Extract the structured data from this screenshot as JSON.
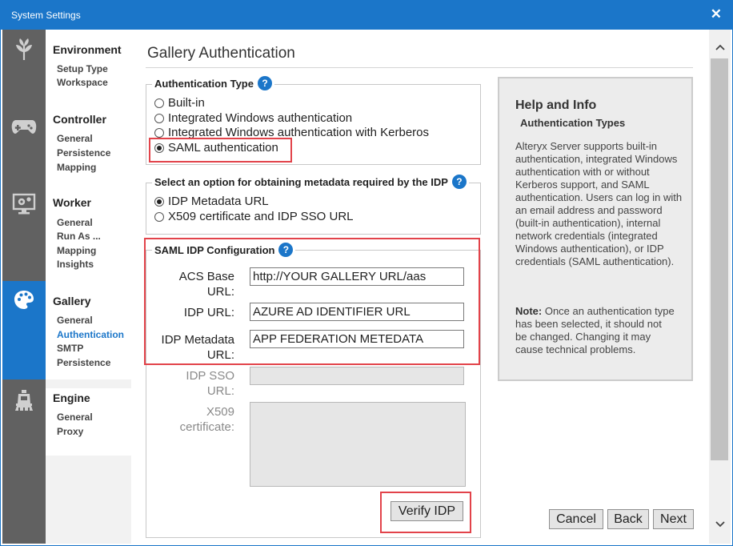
{
  "window": {
    "title": "System Settings",
    "close_icon": "close-icon"
  },
  "sidebar": {
    "groups": [
      {
        "heading": "Environment",
        "icon": "leaf-icon",
        "items": [
          "Setup Type",
          "Workspace"
        ]
      },
      {
        "heading": "Controller",
        "icon": "gamepad-icon",
        "items": [
          "General",
          "Persistence",
          "Mapping"
        ]
      },
      {
        "heading": "Worker",
        "icon": "monitor-gear-icon",
        "items": [
          "General",
          "Run As ...",
          "Mapping",
          "Insights"
        ]
      },
      {
        "heading": "Gallery",
        "icon": "palette-icon",
        "items": [
          "General",
          "Authentication",
          "SMTP",
          "Persistence"
        ],
        "active": true,
        "selected_item": "Authentication"
      },
      {
        "heading": "Engine",
        "icon": "train-icon",
        "items": [
          "General",
          "Proxy"
        ]
      }
    ]
  },
  "page": {
    "title": "Gallery Authentication"
  },
  "auth_type": {
    "legend": "Authentication Type",
    "options": [
      "Built-in",
      "Integrated Windows authentication",
      "Integrated Windows authentication with Kerberos",
      "SAML authentication"
    ],
    "selected": "SAML authentication"
  },
  "metadata_option": {
    "legend": "Select an option for obtaining metadata required by the IDP",
    "options": [
      "IDP Metadata URL",
      "X509 certificate and IDP SSO URL"
    ],
    "selected": "IDP Metadata URL"
  },
  "saml_config": {
    "legend": "SAML IDP Configuration",
    "acs_base_url": {
      "label_line1": "ACS Base",
      "label_line2": "URL:",
      "value": "http://YOUR GALLERY URL/aas"
    },
    "idp_url": {
      "label": "IDP URL:",
      "value": "AZURE AD IDENTIFIER URL"
    },
    "idp_metadata_url": {
      "label_line1": "IDP Metadata",
      "label_line2": "URL:",
      "value": "APP FEDERATION METEDATA"
    },
    "idp_sso_url": {
      "label_line1": "IDP SSO",
      "label_line2": "URL:",
      "value": ""
    },
    "x509_certificate": {
      "label_line1": "X509",
      "label_line2": "certificate:",
      "value": ""
    },
    "verify_button": "Verify IDP"
  },
  "help": {
    "title": "Help and Info",
    "subtitle": "Authentication Types",
    "body": "Alteryx Server supports built-in authentication, integrated Windows authentication with or without Kerberos support, and SAML authentication. Users can log in with an email address and password (built-in authentication), internal network credentials (integrated Windows authentication), or IDP credentials (SAML authentication).",
    "note_label": "Note:",
    "note_text": " Once an authentication type has been selected, it should not be changed. Changing it may cause technical problems."
  },
  "footer": {
    "cancel": "Cancel",
    "back": "Back",
    "next": "Next"
  },
  "colors": {
    "accent": "#1b76c9",
    "highlight_box": "#e2434a",
    "icon_bar": "#616161"
  }
}
